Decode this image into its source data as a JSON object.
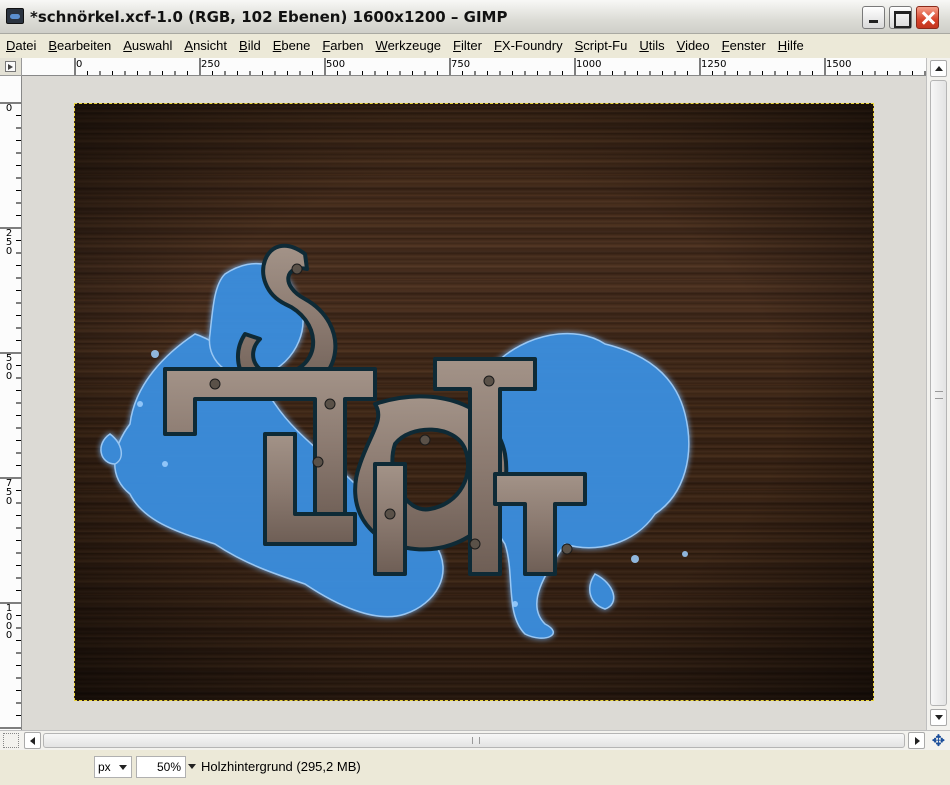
{
  "window": {
    "title": "*schnörkel.xcf-1.0 (RGB, 102 Ebenen) 1600x1200 – GIMP"
  },
  "menu": {
    "items": [
      "Datei",
      "Bearbeiten",
      "Auswahl",
      "Ansicht",
      "Bild",
      "Ebene",
      "Farben",
      "Werkzeuge",
      "Filter",
      "FX-Foundry",
      "Script-Fu",
      "Utils",
      "Video",
      "Fenster",
      "Hilfe"
    ]
  },
  "rulers": {
    "horizontal_labels": [
      "0",
      "250",
      "500",
      "750",
      "1000",
      "1250",
      "1500"
    ],
    "vertical_labels": [
      "0",
      "250",
      "500",
      "750",
      "1000"
    ]
  },
  "statusbar": {
    "unit": "px",
    "zoom": "50%",
    "layer_info": "Holzhintergrund (295,2 MB)"
  },
  "icons": {
    "app": "gimp-wilber-icon",
    "minimize": "minimize-icon",
    "maximize": "maximize-icon",
    "close": "close-icon",
    "navigate": "navigate-icon"
  },
  "colors": {
    "wood": "#3c2616",
    "water_blue": "#3a8fe0",
    "selection_outline": "#e8d43a",
    "close_button": "#d7432a"
  }
}
